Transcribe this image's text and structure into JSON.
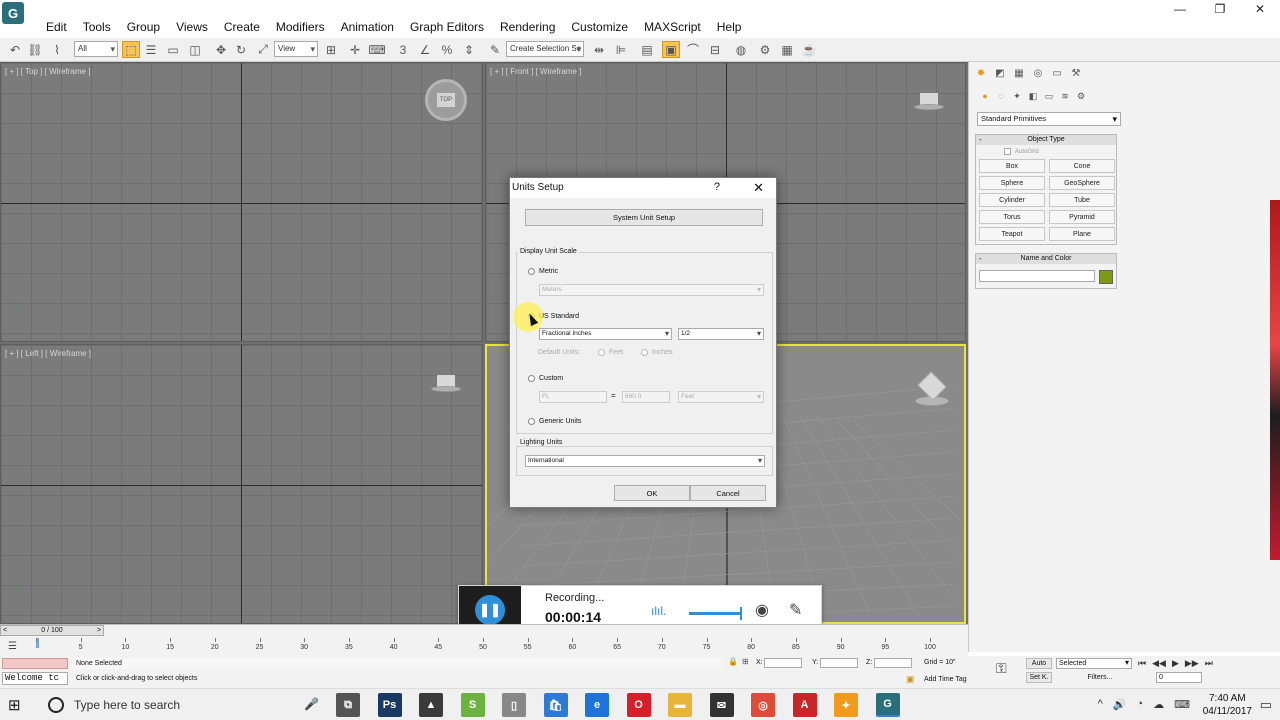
{
  "app": {
    "logo_letter": "G",
    "menu": [
      "Edit",
      "Tools",
      "Group",
      "Views",
      "Create",
      "Modifiers",
      "Animation",
      "Graph Editors",
      "Rendering",
      "Customize",
      "MAXScript",
      "Help"
    ],
    "window_controls": {
      "minimize": "—",
      "maximize": "❐",
      "close": "✕"
    }
  },
  "toolbar": {
    "filter_dd": "All",
    "refcoord_dd": "View",
    "selection_set_dd": "Create Selection Se"
  },
  "viewports": {
    "top": {
      "label": "[ + ] [ Top ] [ Wireframe ]",
      "cube": "TOP"
    },
    "front": {
      "label": "[ + ] [ Front ] [ Wireframe ]"
    },
    "left": {
      "label": "[ + ] [ Left ] [ Wireframe ]"
    }
  },
  "command_panel": {
    "primitives_dd": "Standard Primitives",
    "object_type": {
      "title": "Object Type",
      "autogrid": "AutoGrid",
      "buttons": [
        "Box",
        "Cone",
        "Sphere",
        "GeoSphere",
        "Cylinder",
        "Tube",
        "Torus",
        "Pyramid",
        "Teapot",
        "Plane"
      ]
    },
    "name_color_title": "Name and Color",
    "swatch_color": "#7d9a14"
  },
  "dialog": {
    "title": "Units Setup",
    "help": "?",
    "close": "✕",
    "system_unit_button": "System Unit Setup",
    "display_scale_label": "Display Unit Scale",
    "metric_label": "Metric",
    "metric_dd": "Meters",
    "us_label": "US Standard",
    "us_dd": "Fractional Inches",
    "us_fraction_dd": "1/2",
    "default_units_label": "Default Units:",
    "feet_label": "Feet",
    "inches_label": "Inches",
    "custom_label": "Custom",
    "custom_name": "FL",
    "custom_equals": "=",
    "custom_value": "660.0",
    "custom_unit_dd": "Feet",
    "generic_label": "Generic Units",
    "lighting_label": "Lighting Units",
    "lighting_dd": "International",
    "ok": "OK",
    "cancel": "Cancel"
  },
  "recorder": {
    "pause_icon": "❚❚",
    "status": "Recording...",
    "time": "00:00:14",
    "level_icon": "ılıl.",
    "webcam_icon": "◉",
    "pen_icon": "✎"
  },
  "timeline": {
    "slider": "0 / 100",
    "ticks": [
      5,
      10,
      15,
      20,
      25,
      30,
      35,
      40,
      45,
      50,
      55,
      60,
      65,
      70,
      75,
      80,
      85,
      90,
      95,
      100
    ]
  },
  "status": {
    "maxscript": "Welcome tc",
    "selection": "None Selected",
    "prompt": "Click or click-and-drag to select objects",
    "x_label": "X:",
    "y_label": "Y:",
    "z_label": "Z:",
    "grid": "Grid = 10\"",
    "add_time_tag": "Add Time Tag",
    "auto": "Auto",
    "setk": "Set K.",
    "selected_dd": "Selected",
    "filters": "Filters...",
    "frame": "0"
  },
  "taskbar": {
    "search_placeholder": "Type here to search",
    "time": "7:40 AM",
    "date": "04/11/2017",
    "apps": [
      {
        "name": "task-view",
        "label": "⧉",
        "color": "#555555"
      },
      {
        "name": "photoshop",
        "label": "Ps",
        "color": "#1b3a63"
      },
      {
        "name": "photos",
        "label": "▲",
        "color": "#3b3b3b"
      },
      {
        "name": "sketch",
        "label": "S",
        "color": "#6db33f"
      },
      {
        "name": "file",
        "label": "▯",
        "color": "#888888"
      },
      {
        "name": "store",
        "label": "🛍",
        "color": "#2d7bd6"
      },
      {
        "name": "edge",
        "label": "e",
        "color": "#1e73d8"
      },
      {
        "name": "opera",
        "label": "O",
        "color": "#d4202a"
      },
      {
        "name": "explorer",
        "label": "▬",
        "color": "#e9b43a"
      },
      {
        "name": "mail",
        "label": "✉",
        "color": "#333333"
      },
      {
        "name": "chrome",
        "label": "◎",
        "color": "#dd4b39"
      },
      {
        "name": "acrobat",
        "label": "A",
        "color": "#c8272a"
      },
      {
        "name": "sticky",
        "label": "✦",
        "color": "#f19a1c"
      },
      {
        "name": "3dsmax",
        "label": "G",
        "color": "#2b6f7c"
      }
    ]
  }
}
